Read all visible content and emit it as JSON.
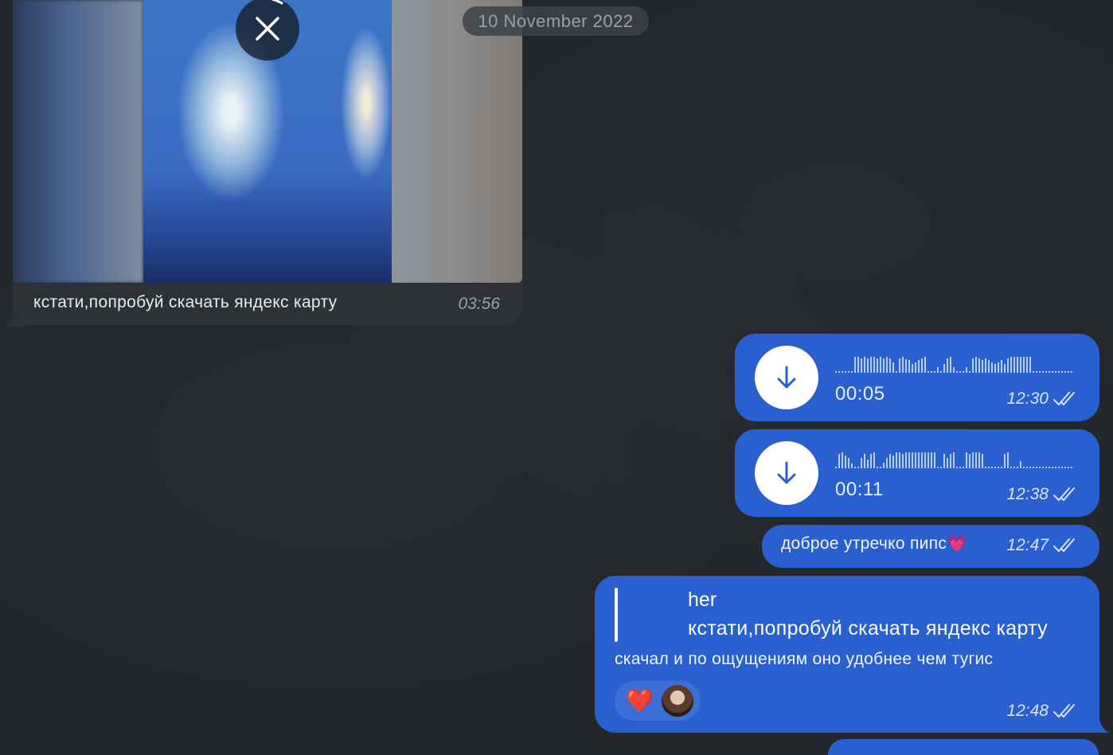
{
  "date_separator": "10 November 2022",
  "incoming": {
    "caption": "кстати,попробуй скачать яндекс карту",
    "time": "03:56"
  },
  "outgoing": [
    {
      "type": "voice",
      "duration": "00:05",
      "time": "12:30"
    },
    {
      "type": "voice",
      "duration": "00:11",
      "time": "12:38"
    },
    {
      "type": "text",
      "text": "доброе утречко пипс💗",
      "time": "12:47"
    },
    {
      "type": "reply",
      "reply_to_name": "her",
      "reply_to_text": "кстати,попробуй скачать яндекс карту",
      "text": "скачал и по ощущениям оно удобнее чем тугис",
      "reaction": "❤️",
      "time": "12:48"
    }
  ],
  "colors": {
    "background": "#23272a",
    "incoming_bubble": "#2e3236",
    "outgoing_bubble": "#2a5fcf"
  },
  "icons": {
    "media_cancel": "close-icon",
    "voice_download": "download-arrow-icon",
    "read_status": "double-check-icon",
    "reaction_user": "avatar"
  }
}
